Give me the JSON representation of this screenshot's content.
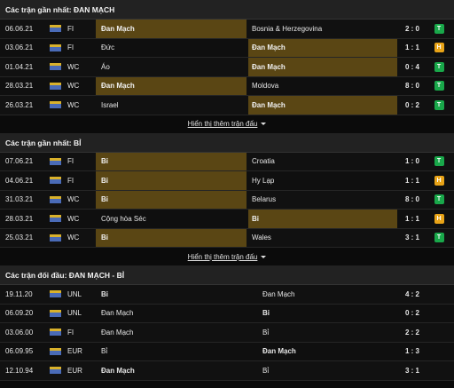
{
  "sections": {
    "recent_home": {
      "title": "Các trận gần nhất: ĐAN MẠCH",
      "more_label": "Hiển thị thêm trận đấu",
      "rows": [
        {
          "date": "06.06.21",
          "league": "FI",
          "home": "Đan Mạch",
          "away": "Bosnia & Herzegovina",
          "score": "2 : 0",
          "result": "T",
          "hl": "home"
        },
        {
          "date": "03.06.21",
          "league": "FI",
          "home": "Đức",
          "away": "Đan Mạch",
          "score": "1 : 1",
          "result": "H",
          "hl": "away"
        },
        {
          "date": "01.04.21",
          "league": "WC",
          "home": "Áo",
          "away": "Đan Mạch",
          "score": "0 : 4",
          "result": "T",
          "hl": "away"
        },
        {
          "date": "28.03.21",
          "league": "WC",
          "home": "Đan Mạch",
          "away": "Moldova",
          "score": "8 : 0",
          "result": "T",
          "hl": "home"
        },
        {
          "date": "26.03.21",
          "league": "WC",
          "home": "Israel",
          "away": "Đan Mạch",
          "score": "0 : 2",
          "result": "T",
          "hl": "away"
        }
      ]
    },
    "recent_away": {
      "title": "Các trận gần nhất: BỈ",
      "more_label": "Hiển thị thêm trận đấu",
      "rows": [
        {
          "date": "07.06.21",
          "league": "FI",
          "home": "Bỉ",
          "away": "Croatia",
          "score": "1 : 0",
          "result": "T",
          "hl": "home"
        },
        {
          "date": "04.06.21",
          "league": "FI",
          "home": "Bỉ",
          "away": "Hy Lạp",
          "score": "1 : 1",
          "result": "H",
          "hl": "home"
        },
        {
          "date": "31.03.21",
          "league": "WC",
          "home": "Bỉ",
          "away": "Belarus",
          "score": "8 : 0",
          "result": "T",
          "hl": "home"
        },
        {
          "date": "28.03.21",
          "league": "WC",
          "home": "Cộng hòa Séc",
          "away": "Bỉ",
          "score": "1 : 1",
          "result": "H",
          "hl": "away"
        },
        {
          "date": "25.03.21",
          "league": "WC",
          "home": "Bỉ",
          "away": "Wales",
          "score": "3 : 1",
          "result": "T",
          "hl": "home"
        }
      ]
    },
    "h2h": {
      "title": "Các trận đối đầu: ĐAN MẠCH - BỈ",
      "rows": [
        {
          "date": "19.11.20",
          "league": "UNL",
          "home": "Bỉ",
          "away": "Đan Mạch",
          "score": "4 : 2",
          "bold": "home"
        },
        {
          "date": "06.09.20",
          "league": "UNL",
          "home": "Đan Mạch",
          "away": "Bỉ",
          "score": "0 : 2",
          "bold": "away"
        },
        {
          "date": "03.06.00",
          "league": "FI",
          "home": "Đan Mạch",
          "away": "Bỉ",
          "score": "2 : 2",
          "bold": "none"
        },
        {
          "date": "06.09.95",
          "league": "EUR",
          "home": "Bỉ",
          "away": "Đan Mạch",
          "score": "1 : 3",
          "bold": "away"
        },
        {
          "date": "12.10.94",
          "league": "EUR",
          "home": "Đan Mạch",
          "away": "Bỉ",
          "score": "3 : 1",
          "bold": "home"
        }
      ]
    }
  },
  "colors": {
    "highlight": "#5a4614",
    "win": "#19a84a",
    "draw": "#e8a317"
  },
  "icons": {
    "league_flag": "league-flag-icon",
    "more_caret": "caret-down-icon"
  }
}
